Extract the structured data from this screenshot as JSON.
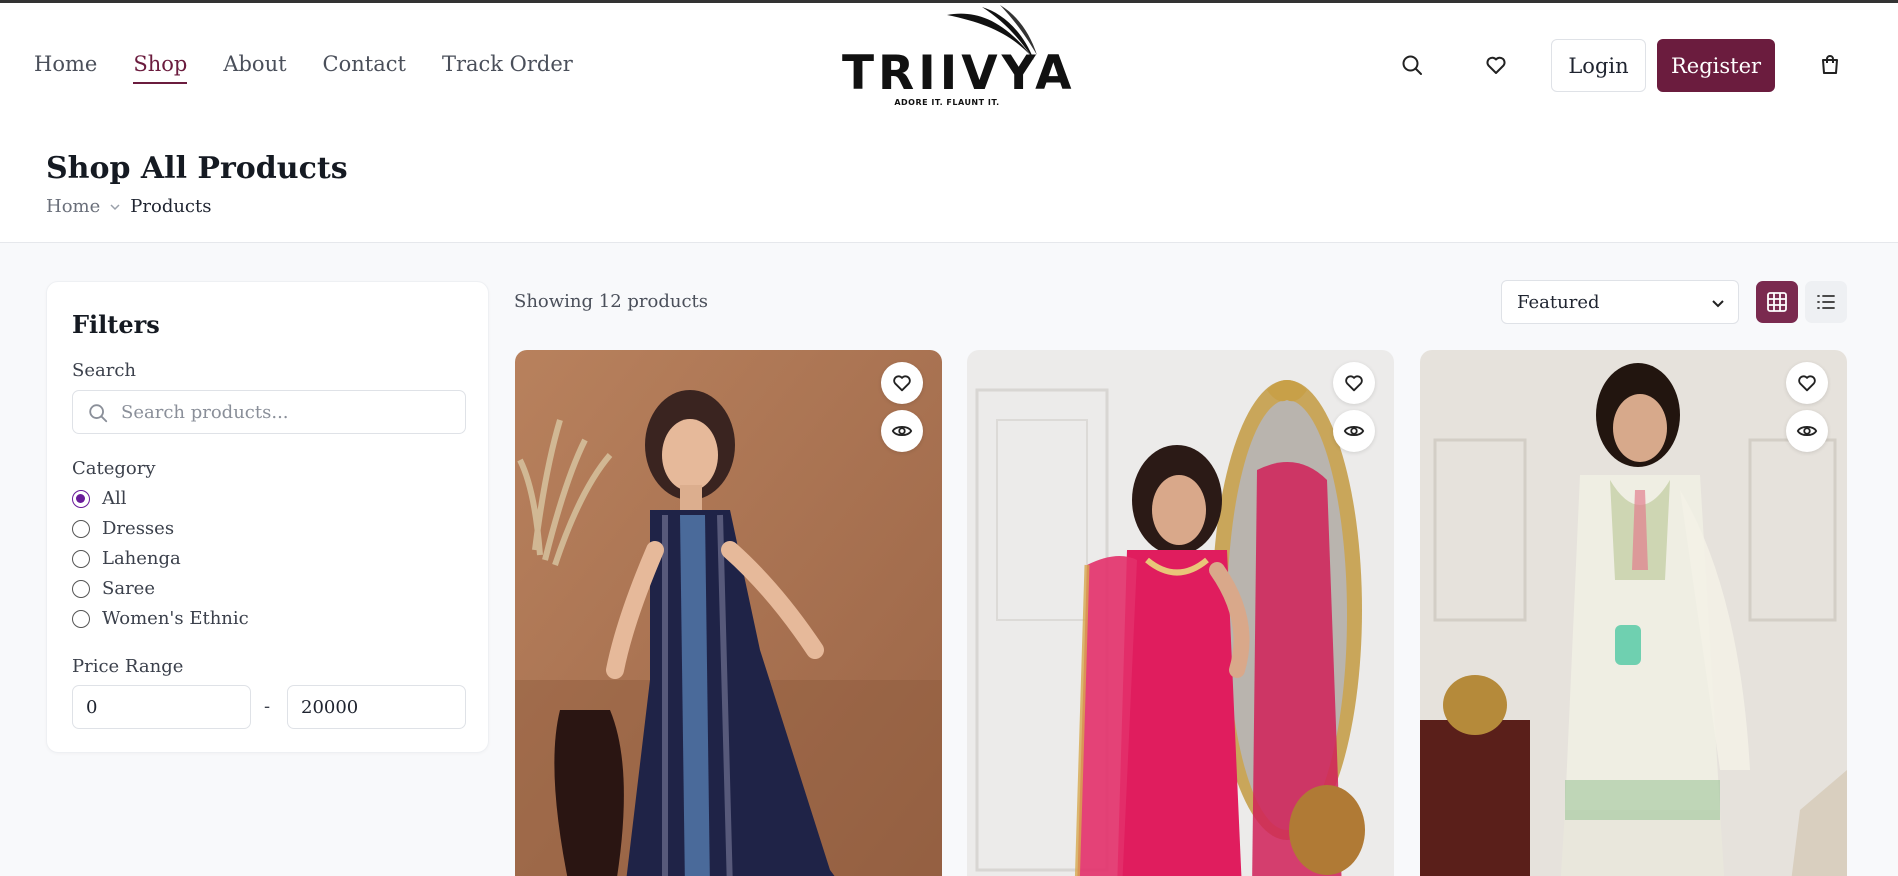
{
  "nav": {
    "items": [
      {
        "label": "Home",
        "active": false
      },
      {
        "label": "Shop",
        "active": true
      },
      {
        "label": "About",
        "active": false
      },
      {
        "label": "Contact",
        "active": false
      },
      {
        "label": "Track Order",
        "active": false
      }
    ]
  },
  "brand": {
    "name": "TRIIVYA",
    "tagline": "ADORE IT. FLAUNT IT.",
    "accent_color": "#6b1c3e"
  },
  "header_actions": {
    "search_icon": "search-icon",
    "wishlist_icon": "heart-icon",
    "login_label": "Login",
    "register_label": "Register",
    "cart_icon": "shopping-bag-icon"
  },
  "page": {
    "title": "Shop All Products",
    "breadcrumb": {
      "home": "Home",
      "current": "Products"
    }
  },
  "filters": {
    "title": "Filters",
    "search_label": "Search",
    "search_placeholder": "Search products...",
    "category_label": "Category",
    "categories": [
      {
        "label": "All",
        "checked": true
      },
      {
        "label": "Dresses",
        "checked": false
      },
      {
        "label": "Lahenga",
        "checked": false
      },
      {
        "label": "Saree",
        "checked": false
      },
      {
        "label": "Women's Ethnic",
        "checked": false
      }
    ],
    "price_label": "Price Range",
    "price_min": "0",
    "price_max": "20000",
    "price_separator": "-"
  },
  "listing": {
    "showing_text": "Showing 12 products",
    "sort_selected": "Featured",
    "view_mode": "grid"
  },
  "products": [
    {
      "image": "navy embroidered long kurta with jeans",
      "wishlist_icon": "heart-icon",
      "quickview_icon": "eye-icon"
    },
    {
      "image": "pink kurta set with dupatta",
      "wishlist_icon": "heart-icon",
      "quickview_icon": "eye-icon"
    },
    {
      "image": "ivory embroidered kurta set with dupatta",
      "wishlist_icon": "heart-icon",
      "quickview_icon": "eye-icon"
    }
  ]
}
